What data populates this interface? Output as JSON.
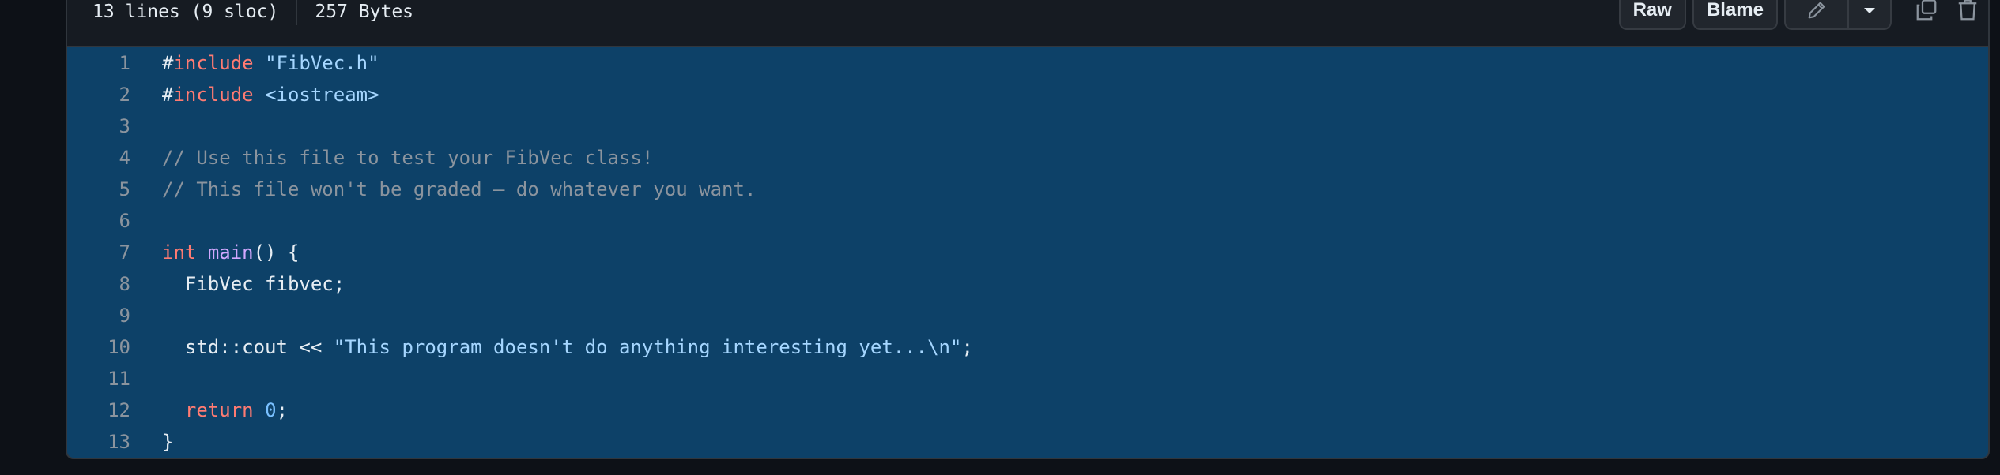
{
  "file_header": {
    "lines_info": "13 lines (9 sloc)",
    "size_info": "257 Bytes",
    "raw_label": "Raw",
    "blame_label": "Blame"
  },
  "colors": {
    "background": "#0d1117",
    "highlight": "#0d4168",
    "keyword": "#ff7b72",
    "string": "#a5d6ff",
    "comment": "#8b949e",
    "function": "#d2a8ff",
    "number": "#79c0ff"
  },
  "icons": [
    "pencil-icon",
    "chevron-down-icon",
    "copy-icon",
    "trash-icon"
  ],
  "code": {
    "line_numbers": [
      "1",
      "2",
      "3",
      "4",
      "5",
      "6",
      "7",
      "8",
      "9",
      "10",
      "11",
      "12",
      "13"
    ],
    "l1": {
      "hash": "#",
      "kw": "include",
      "sp": " ",
      "str": "\"FibVec.h\""
    },
    "l2": {
      "hash": "#",
      "kw": "include",
      "sp": " ",
      "str": "<iostream>"
    },
    "l4": {
      "com": "// Use this file to test your FibVec class!"
    },
    "l5": {
      "com": "// This file won't be graded — do whatever you want."
    },
    "l7": {
      "kw": "int",
      "sp": " ",
      "fn": "main",
      "rest": "() {"
    },
    "l8": {
      "text": "  FibVec fibvec;"
    },
    "l10": {
      "pre": "  std::cout << ",
      "str": "\"This program doesn't do anything interesting yet...\\n\"",
      "post": ";"
    },
    "l12": {
      "indent": "  ",
      "kw": "return",
      "sp": " ",
      "num": "0",
      "post": ";"
    },
    "l13": {
      "text": "}"
    }
  }
}
